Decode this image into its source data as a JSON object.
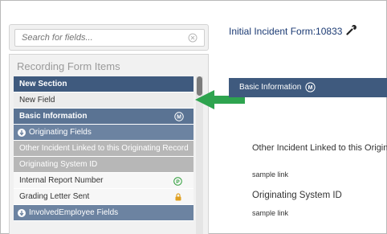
{
  "search": {
    "placeholder": "Search for fields...",
    "clear_icon": "circle-x-icon"
  },
  "panel": {
    "title": "Recording Form Items",
    "rows": [
      {
        "label": "New Section",
        "kind": "section"
      },
      {
        "label": "New Field",
        "kind": "field"
      },
      {
        "label": "Basic Information",
        "kind": "group",
        "badge": "M"
      },
      {
        "label": "Originating Fields",
        "kind": "sub",
        "icon": "circle-arrow-down-icon"
      },
      {
        "label": "Other Incident Linked to this Originating Record",
        "kind": "gray"
      },
      {
        "label": "Originating System ID",
        "kind": "gray"
      },
      {
        "label": "Internal Report Number",
        "kind": "white",
        "badge": "P"
      },
      {
        "label": "Grading Letter Sent",
        "kind": "white",
        "icon": "lock-icon"
      },
      {
        "label": "InvolvedEmployee Fields",
        "kind": "sub",
        "icon": "circle-arrow-down-icon"
      }
    ]
  },
  "form": {
    "title": "Initial Incident Form:10833",
    "header_label": "Basic Information",
    "header_badge": "M",
    "field1_label": "Other Incident Linked to this Origina",
    "field1_link": "sample link",
    "field2_label": "Originating System ID",
    "field2_link": "sample link"
  },
  "colors": {
    "section": "#3f5a7e",
    "title": "#1b3a73",
    "arrow": "#2ea44f",
    "badge_p": "#2e9e3a",
    "lock": "#e0a020"
  }
}
